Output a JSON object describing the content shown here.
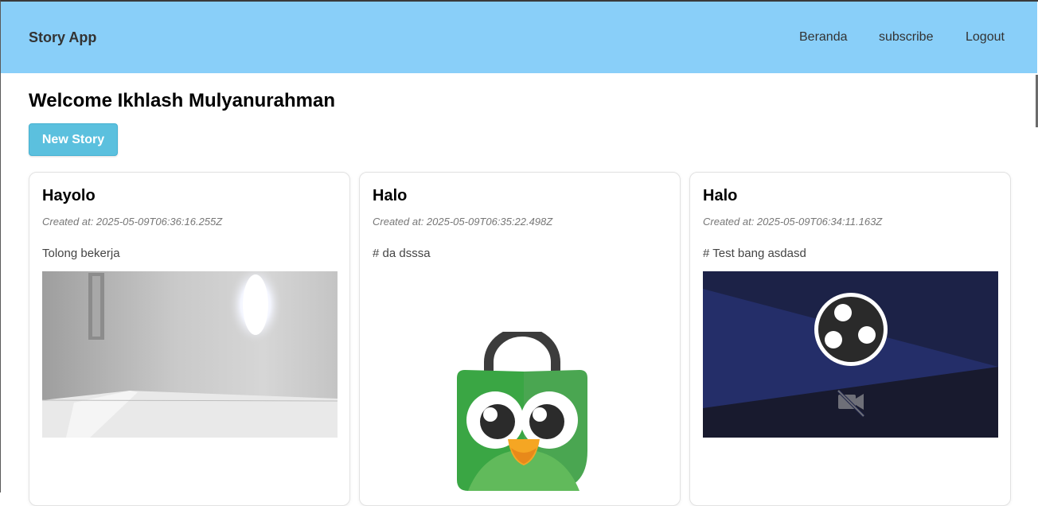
{
  "navbar": {
    "brand": "Story App",
    "links": [
      "Beranda",
      "subscribe",
      "Logout"
    ],
    "background": "#89cff9"
  },
  "welcome": "Welcome Ikhlash Mulyanurahman",
  "new_story_label": "New Story",
  "stories": [
    {
      "title": "Hayolo",
      "created_at": "Created at: 2025-05-09T06:36:16.255Z",
      "description": "Tolong bekerja",
      "image": "room-photo"
    },
    {
      "title": "Halo",
      "created_at": "Created at: 2025-05-09T06:35:22.498Z",
      "description": "# da dsssa",
      "image": "green-owl-shopping-bag-logo"
    },
    {
      "title": "Halo",
      "created_at": "Created at: 2025-05-09T06:34:11.163Z",
      "description": "# Test bang asdasd",
      "image": "obs-logo-camera-off-screen"
    }
  ],
  "colors": {
    "button": "#5bc0de",
    "card_border": "#e2e2e2"
  }
}
